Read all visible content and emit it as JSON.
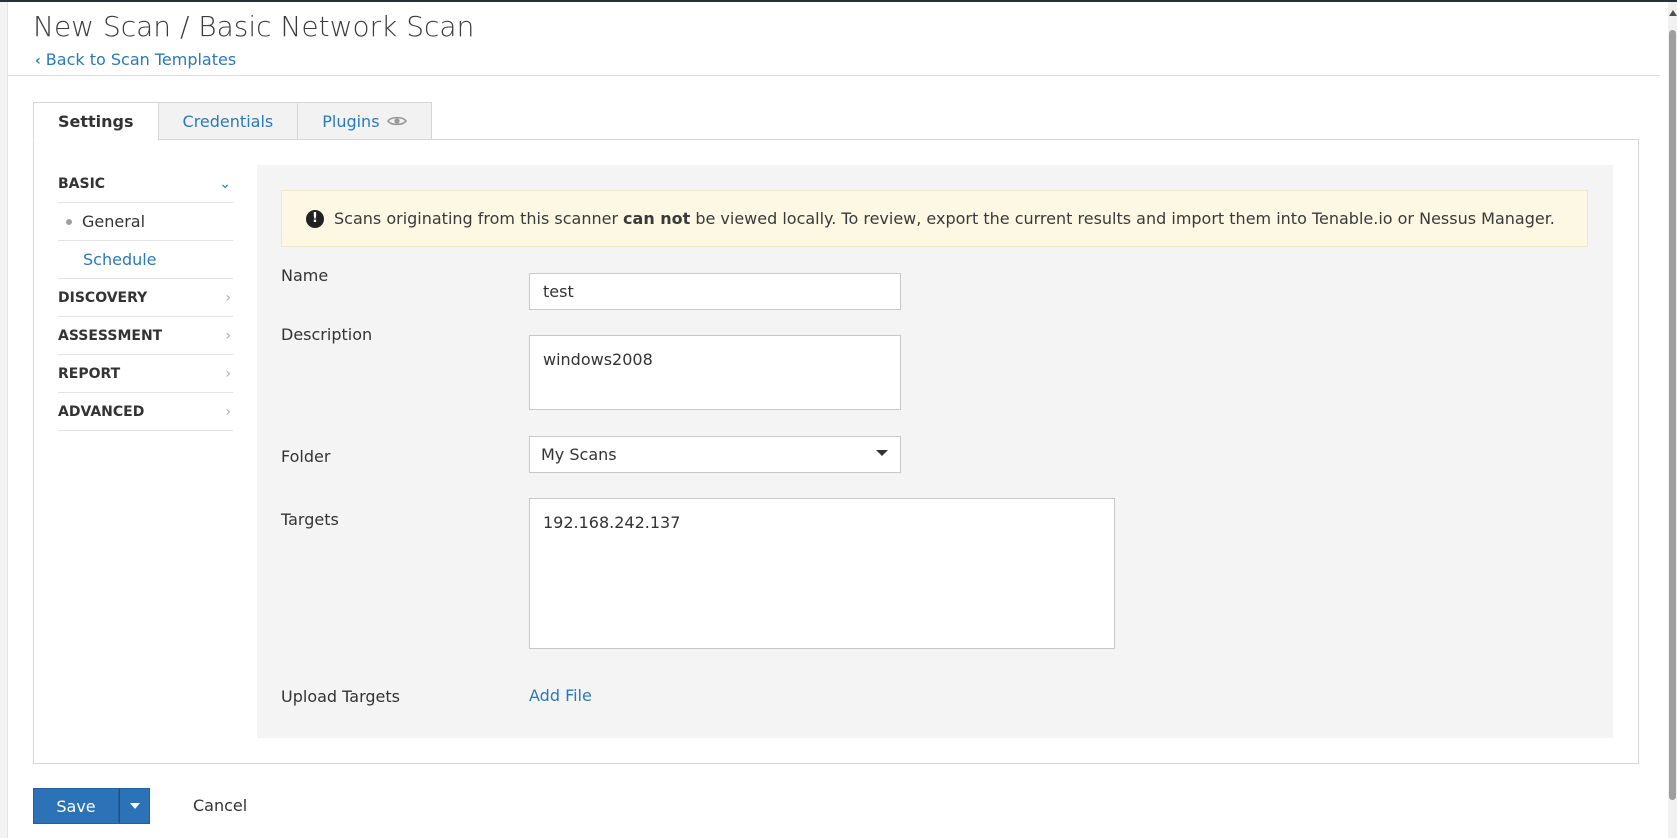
{
  "header": {
    "title": "New Scan / Basic Network Scan",
    "back_link": "Back to Scan Templates"
  },
  "tabs": [
    {
      "label": "Settings",
      "active": true
    },
    {
      "label": "Credentials",
      "active": false
    },
    {
      "label": "Plugins",
      "active": false,
      "icon": "eye-icon"
    }
  ],
  "sidebar": {
    "sections": [
      {
        "label": "BASIC",
        "expanded": true,
        "items": [
          {
            "label": "General",
            "active": true
          },
          {
            "label": "Schedule",
            "active": false
          }
        ]
      },
      {
        "label": "DISCOVERY",
        "expanded": false
      },
      {
        "label": "ASSESSMENT",
        "expanded": false
      },
      {
        "label": "REPORT",
        "expanded": false
      },
      {
        "label": "ADVANCED",
        "expanded": false
      }
    ]
  },
  "alert": {
    "icon": "exclamation-circle-icon",
    "text_before": "Scans originating from this scanner",
    "text_bold": "can not",
    "text_after": "be viewed locally. To review, export the current results and import them into Tenable.io or Nessus Manager."
  },
  "form": {
    "name": {
      "label": "Name",
      "value": "test"
    },
    "description": {
      "label": "Description",
      "value": "windows2008"
    },
    "folder": {
      "label": "Folder",
      "value": "My Scans"
    },
    "targets": {
      "label": "Targets",
      "value": "192.168.242.137"
    },
    "upload_targets": {
      "label": "Upload Targets",
      "link": "Add File"
    }
  },
  "footer": {
    "save_label": "Save",
    "cancel_label": "Cancel"
  },
  "colors": {
    "link": "#2a7ab8",
    "primary_button": "#2b72b7",
    "alert_bg": "#fcf8e3",
    "content_bg": "#f4f4f4"
  }
}
